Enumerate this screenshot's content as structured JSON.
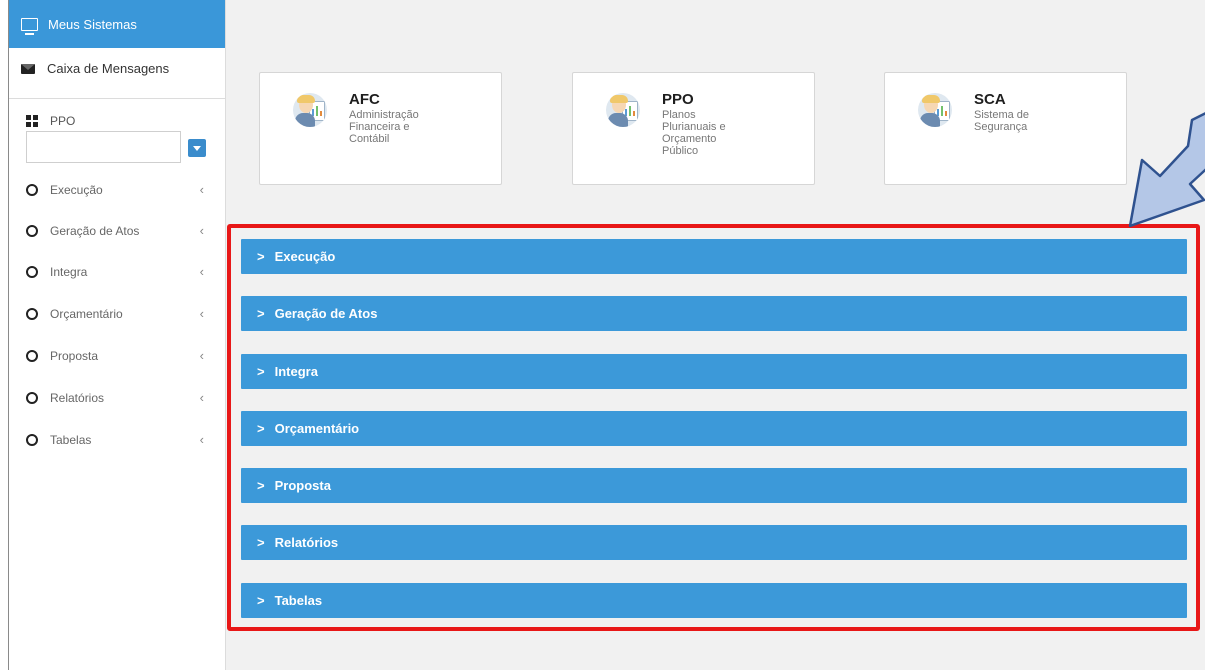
{
  "sidebar": {
    "top_item": "Meus Sistemas",
    "messages": "Caixa de Mensagens",
    "module": "PPO",
    "select_value": "",
    "menu": [
      {
        "label": "Execução"
      },
      {
        "label": "Geração de Atos"
      },
      {
        "label": "Integra"
      },
      {
        "label": "Orçamentário"
      },
      {
        "label": "Proposta"
      },
      {
        "label": "Relatórios"
      },
      {
        "label": "Tabelas"
      }
    ]
  },
  "cards": [
    {
      "title": "AFC",
      "desc": "Administração\nFinanceira e\nContábil"
    },
    {
      "title": "PPO",
      "desc": "Planos\nPlurianuais e\nOrçamento\nPúblico"
    },
    {
      "title": "SCA",
      "desc": "Sistema de\nSegurança"
    }
  ],
  "accordions": [
    {
      "label": "Execução"
    },
    {
      "label": "Geração de Atos"
    },
    {
      "label": "Integra"
    },
    {
      "label": "Orçamentário"
    },
    {
      "label": "Proposta"
    },
    {
      "label": "Relatórios"
    },
    {
      "label": "Tabelas"
    }
  ],
  "colors": {
    "accent": "#3a97d9",
    "highlight": "#e81717",
    "arrow_fill": "#b4c7e7",
    "arrow_stroke": "#2f528f"
  }
}
